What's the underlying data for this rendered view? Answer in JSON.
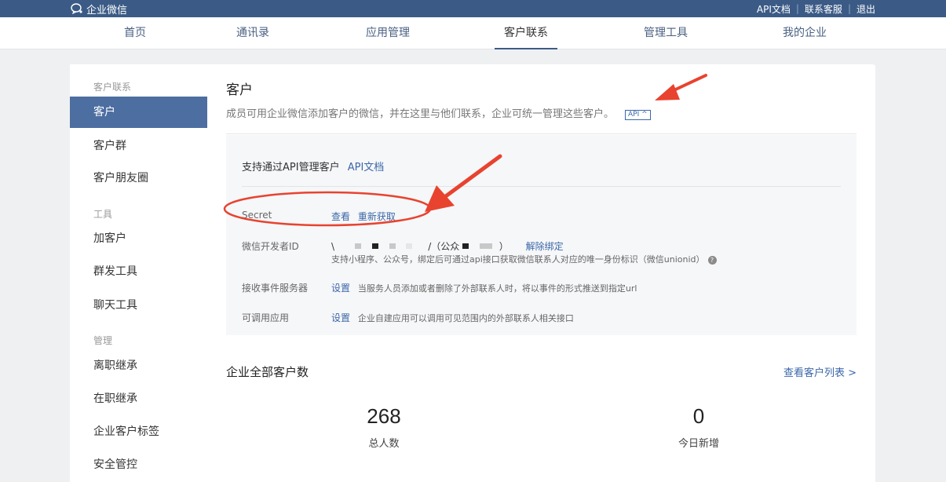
{
  "topbar": {
    "logo_text": "企业微信",
    "links": [
      "API文档",
      "联系客服",
      "退出"
    ]
  },
  "nav": {
    "tabs": [
      "首页",
      "通讯录",
      "应用管理",
      "客户联系",
      "管理工具",
      "我的企业"
    ],
    "active_tab": "客户联系"
  },
  "sidebar": {
    "groups": {
      "contact": "客户联系",
      "tools": "工具",
      "manage": "管理"
    },
    "items": {
      "customer": "客户",
      "customer_group": "客户群",
      "moments": "客户朋友圈",
      "add_customer": "加客户",
      "mass_send": "群发工具",
      "chat_tools": "聊天工具",
      "resign_inherit": "离职继承",
      "onjob_inherit": "在职继承",
      "tags": "企业客户标签",
      "security": "安全管控"
    },
    "active_item": "客户"
  },
  "main": {
    "title": "客户",
    "description": "成员可用企业微信添加客户的微信，并在这里与他们联系，企业可统一管理这些客户。",
    "api_badge": "API ^",
    "support_text": "支持通过API管理客户",
    "support_link": "API文档",
    "rows": {
      "secret_label": "Secret",
      "secret_view": "查看",
      "secret_refresh": "重新获取",
      "devid_label": "微信开发者ID",
      "devid_prefix": "\\",
      "devid_mid": "/（公众",
      "devid_suffix": "）",
      "devid_unbind": "解除绑定",
      "devid_hint": "支持小程序、公众号，绑定后可通过api接口获取微信联系人对应的唯一身份标识（微信unionid）",
      "event_label": "接收事件服务器",
      "event_set": "设置",
      "event_hint": "当服务人员添加或者删除了外部联系人时，将以事件的形式推送到指定url",
      "app_label": "可调用应用",
      "app_set": "设置",
      "app_hint": "企业自建应用可以调用可见范围内的外部联系人相关接口"
    },
    "stats_title": "企业全部客户数",
    "view_list": "查看客户列表 >",
    "stats": {
      "total_value": "268",
      "total_label": "总人数",
      "today_value": "0",
      "today_label": "今日新增"
    }
  },
  "colors": {
    "topbar": "#3b5b86",
    "accent": "#4d6ea0",
    "link": "#3b67a8",
    "annotation": "#e8432f"
  }
}
